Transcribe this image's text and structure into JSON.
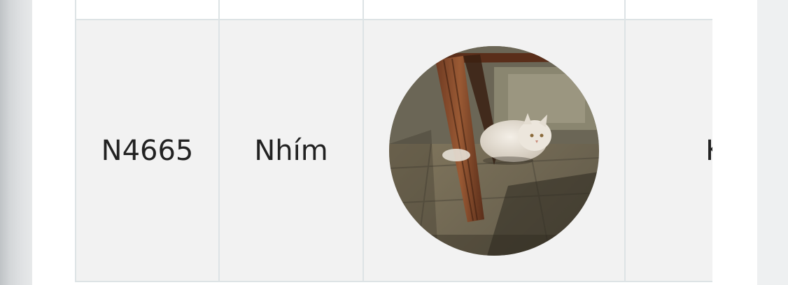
{
  "table": {
    "rows": [
      {
        "code": "N4665",
        "name": "Nhím",
        "photo_icon": "cat-photo",
        "attribute": "Kích"
      }
    ]
  },
  "colors": {
    "border": "#dde3e5",
    "row_background": "#f2f2f2",
    "card_background": "#ffffff"
  }
}
